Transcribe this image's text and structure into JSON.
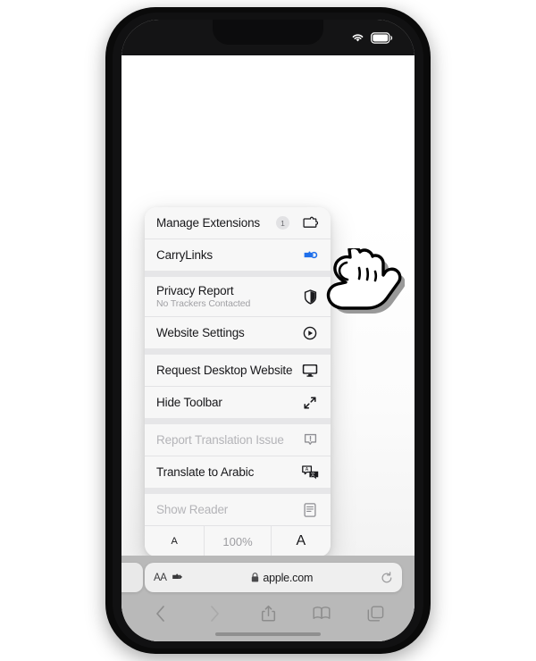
{
  "device": {
    "status_bar": {
      "wifi_icon": "wifi-icon",
      "battery_icon": "battery-icon"
    },
    "home_indicator": "home-indicator"
  },
  "menu": {
    "groups": [
      {
        "rows": [
          {
            "label": "Manage Extensions",
            "badge": "1",
            "icon": "puzzle-piece-icon",
            "name": "manage-extensions",
            "dim": false
          },
          {
            "label": "CarryLinks",
            "icon": "carrylinks-extension-icon",
            "name": "carrylinks",
            "dim": false
          }
        ]
      },
      {
        "rows": [
          {
            "label": "Privacy Report",
            "sub": "No Trackers Contacted",
            "icon": "shield-half-icon",
            "name": "privacy-report",
            "dim": false
          },
          {
            "label": "Website Settings",
            "icon": "gear-circle-icon",
            "name": "website-settings",
            "dim": false
          }
        ]
      },
      {
        "rows": [
          {
            "label": "Request Desktop Website",
            "icon": "desktop-monitor-icon",
            "name": "request-desktop-website",
            "dim": false
          },
          {
            "label": "Hide Toolbar",
            "icon": "diagonal-arrows-icon",
            "name": "hide-toolbar",
            "dim": false
          }
        ]
      },
      {
        "rows": [
          {
            "label": "Report Translation Issue",
            "icon": "speech-bubble-exclamation-icon",
            "name": "report-translation-issue",
            "dim": true
          },
          {
            "label": "Translate to Arabic",
            "icon": "translate-bubbles-icon",
            "name": "translate-to-arabic",
            "dim": false
          }
        ]
      },
      {
        "rows": [
          {
            "label": "Show Reader",
            "icon": "reader-document-icon",
            "name": "show-reader",
            "dim": true
          }
        ]
      }
    ],
    "size_row": {
      "decrease_label": "A",
      "zoom_label": "100%",
      "increase_label": "A"
    }
  },
  "safari_bar": {
    "text_size_label": "AA",
    "extension_icon": "puzzle-piece-icon",
    "lock_icon": "lock-icon",
    "url": "apple.com",
    "reload_icon": "reload-icon",
    "tools": [
      {
        "name": "back-button",
        "icon": "chevron-left-icon",
        "disabled": false
      },
      {
        "name": "forward-button",
        "icon": "chevron-right-icon",
        "disabled": true
      },
      {
        "name": "share-button",
        "icon": "share-icon",
        "disabled": false
      },
      {
        "name": "bookmarks-button",
        "icon": "book-icon",
        "disabled": false
      },
      {
        "name": "tabs-button",
        "icon": "tabs-icon",
        "disabled": false
      }
    ]
  },
  "cursor": {
    "icon": "pointing-hand-cursor"
  },
  "colors": {
    "accent_blue": "#1f6feb",
    "menu_bg": "#f7f7f7",
    "separator": "#e6e6e8",
    "toolbar_bg": "#b9b9b9",
    "frame": "#111112"
  }
}
